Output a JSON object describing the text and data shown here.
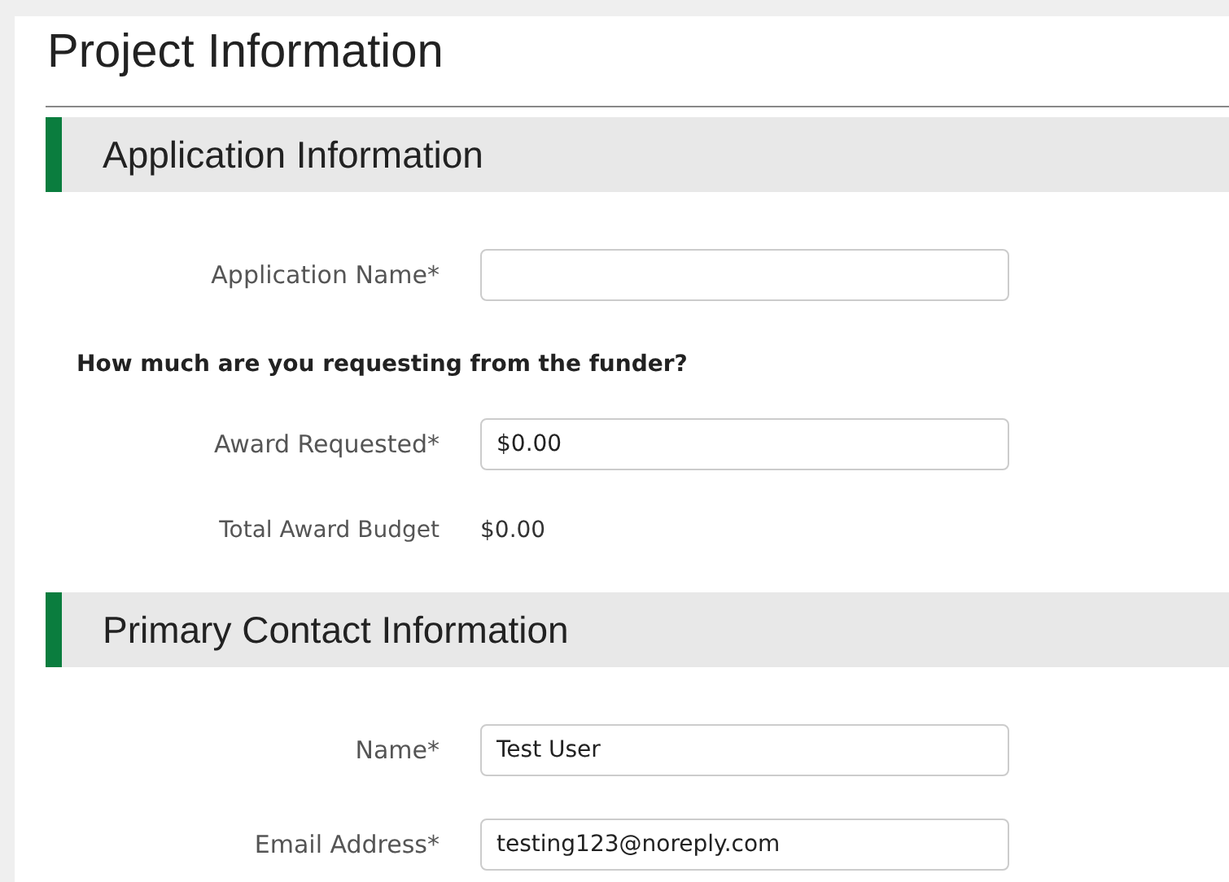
{
  "page": {
    "title": "Project Information"
  },
  "sections": [
    {
      "title": "Application Information",
      "items": [
        {
          "kind": "field",
          "label": "Application Name*"
        },
        {
          "kind": "question",
          "text": "How much are you requesting from the funder?"
        },
        {
          "kind": "field",
          "label": "Award Requested*",
          "value": "$0.00"
        },
        {
          "kind": "readonly",
          "label": "Total Award Budget",
          "value": "$0.00"
        }
      ]
    },
    {
      "title": "Primary Contact Information",
      "items": [
        {
          "kind": "field",
          "label": "Name*",
          "value": "Test User"
        },
        {
          "kind": "field",
          "label": "Email Address*",
          "value": "testing123@noreply.com"
        }
      ]
    }
  ]
}
